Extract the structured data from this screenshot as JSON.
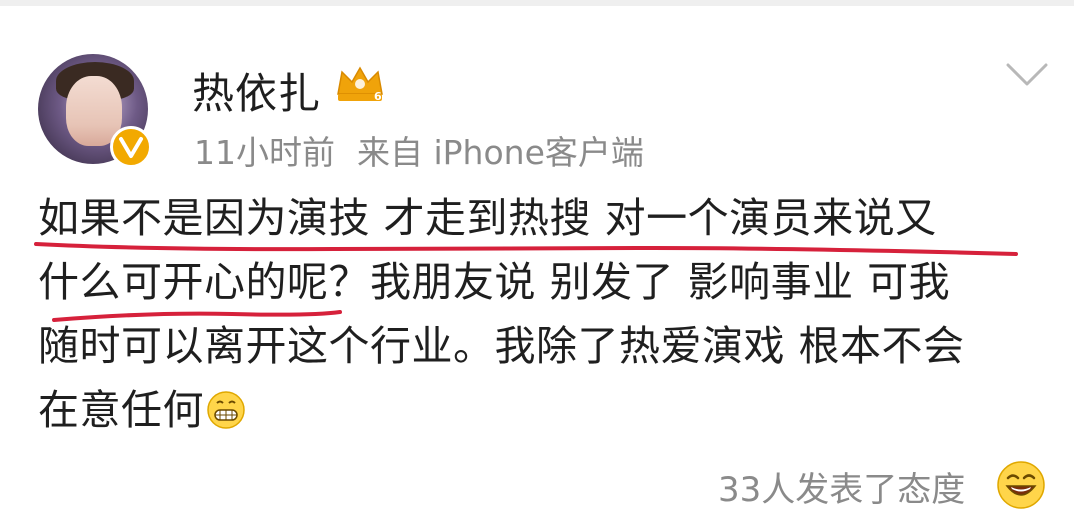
{
  "post": {
    "author": "热依扎",
    "time": "11小时前",
    "source": "来自 iPhone客户端",
    "content_lines": [
      "如果不是因为演技 才走到热搜 对一个演员来说又",
      "什么可开心的呢？我朋友说 别发了 影响事业 可我",
      "随时可以离开这个行业。我除了热爱演戏 根本不会",
      "在意任何"
    ],
    "reactions": "33人发表了态度"
  },
  "icons": {
    "vip": "vip-crown-icon",
    "verified": "verified-v-icon",
    "more": "chevron-down-icon",
    "inline_emoji": "grin-emoji-icon",
    "reaction_emoji": "laugh-emoji-icon"
  },
  "colors": {
    "underline": "#d6213b",
    "verified": "#f2a900",
    "vip": "#f0a30a",
    "meta": "#8a8a8a"
  }
}
